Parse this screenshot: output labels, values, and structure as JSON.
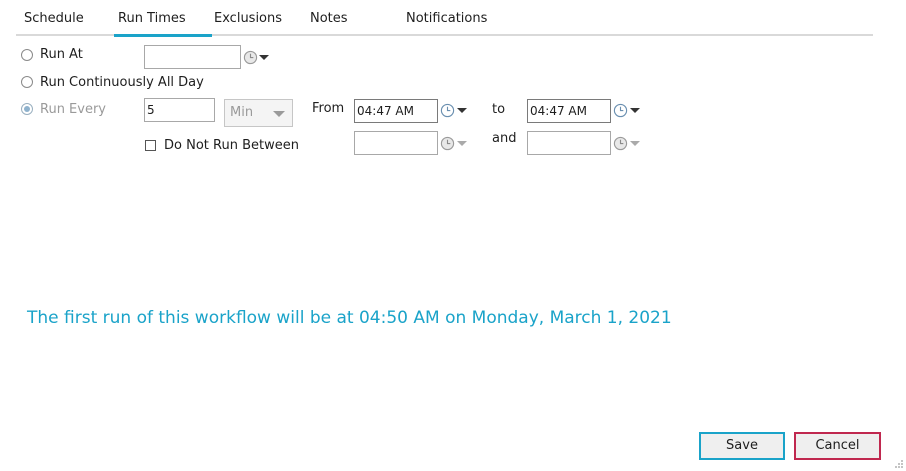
{
  "tabs": [
    {
      "label": "Schedule",
      "active": false
    },
    {
      "label": "Run Times",
      "active": true
    },
    {
      "label": "Exclusions",
      "active": false
    },
    {
      "label": "Notes",
      "active": false
    },
    {
      "label": "Notifications",
      "active": false
    }
  ],
  "run_at": {
    "label": "Run At",
    "value": ""
  },
  "run_continuously": {
    "label": "Run Continuously All Day"
  },
  "run_every": {
    "label": "Run Every",
    "interval_value": "5",
    "unit_selected": "Min"
  },
  "from": {
    "label": "From",
    "value": "04:47 AM"
  },
  "to": {
    "label": "to",
    "value": "04:47 AM"
  },
  "do_not_run": {
    "label": "Do Not Run Between",
    "checked": false,
    "start_value": "",
    "end_value": ""
  },
  "and_label": "and",
  "message": "The first run of this workflow will be at 04:50 AM on Monday, March 1, 2021",
  "buttons": {
    "save": "Save",
    "cancel": "Cancel"
  },
  "colors": {
    "accent": "#1aa3c9",
    "cancel_border": "#c0284f"
  },
  "icons": {
    "clock": "clock-icon",
    "dropdown": "chevron-down-icon"
  }
}
